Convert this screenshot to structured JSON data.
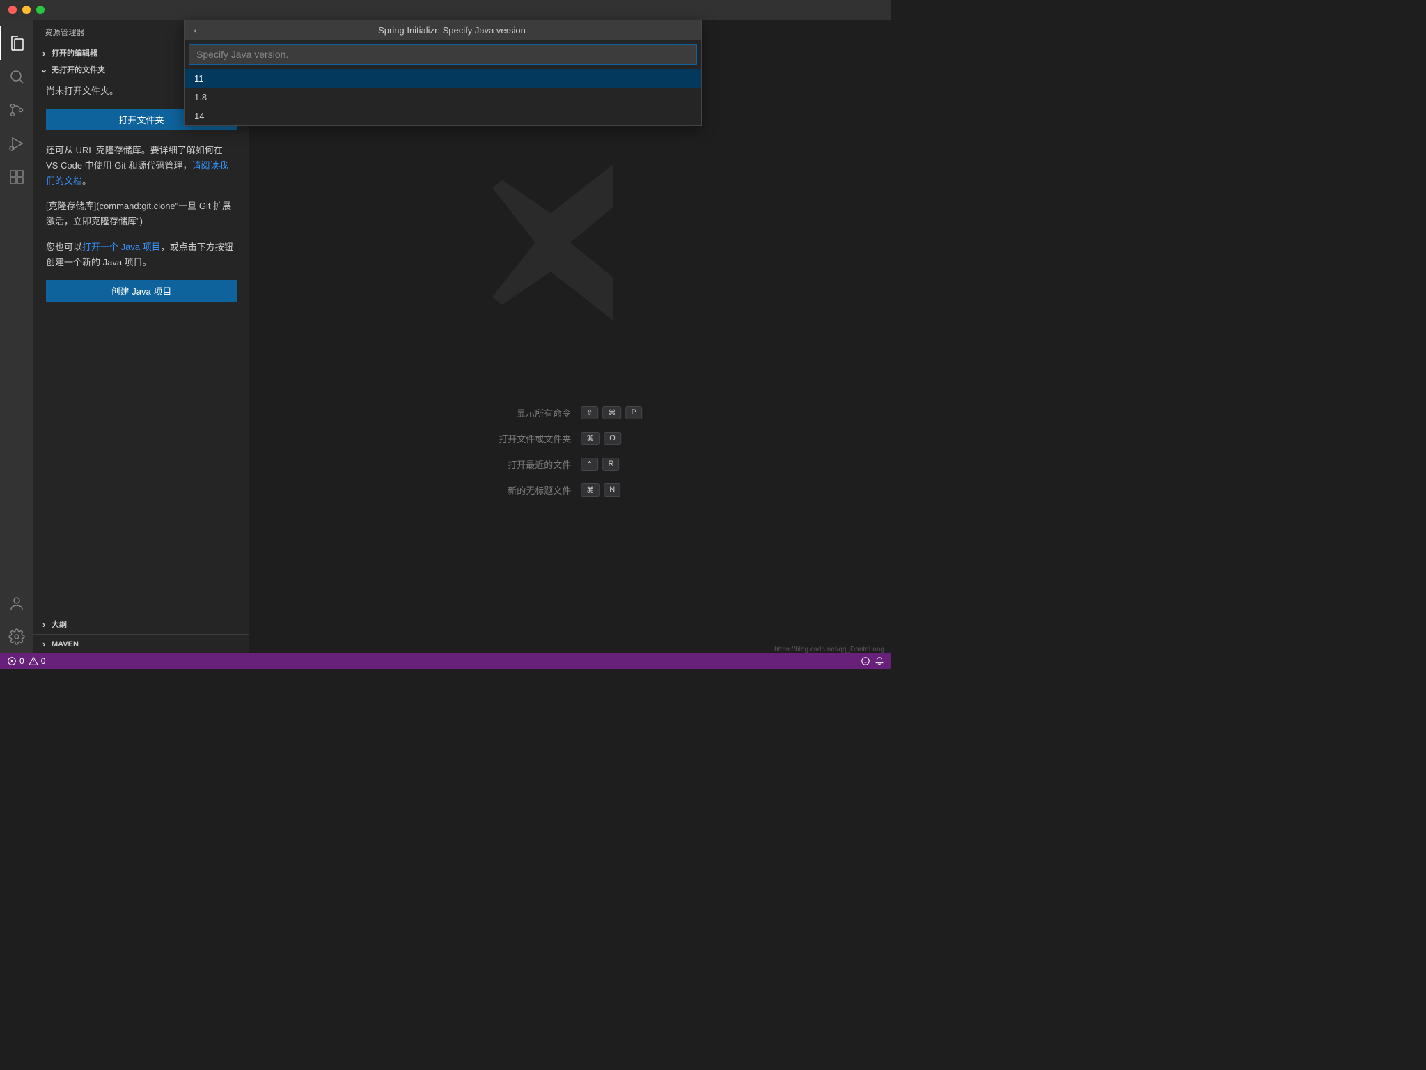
{
  "sidebar": {
    "title": "资源管理器",
    "sections": {
      "openEditors": "打开的编辑器",
      "noFolder": "无打开的文件夹",
      "outline": "大纲",
      "maven": "MAVEN"
    },
    "body": {
      "noFolderMsg": "尚未打开文件夹。",
      "openFolderBtn": "打开文件夹",
      "cloneText1": "还可从 URL 克隆存储库。要详细了解如何在 VS Code 中使用 Git 和源代码管理，",
      "cloneLink": "请阅读我们的文档",
      "cloneText2": "。",
      "cloneCommand": "[克隆存储库](command:git.clone\"一旦 Git 扩展激活，立即克隆存储库\")",
      "javaText1": "您也可以",
      "javaLink": "打开一个 Java 项目",
      "javaText2": "，或点击下方按钮创建一个新的 Java 项目。",
      "createJavaBtn": "创建 Java 项目"
    }
  },
  "quickpick": {
    "title": "Spring Initializr: Specify Java version",
    "placeholder": "Specify Java version.",
    "options": [
      "11",
      "1.8",
      "14"
    ]
  },
  "shortcuts": {
    "items": [
      {
        "label": "显示所有命令",
        "keys": [
          "⇧",
          "⌘",
          "P"
        ]
      },
      {
        "label": "打开文件或文件夹",
        "keys": [
          "⌘",
          "O"
        ]
      },
      {
        "label": "打开最近的文件",
        "keys": [
          "⌃",
          "R"
        ]
      },
      {
        "label": "新的无标题文件",
        "keys": [
          "⌘",
          "N"
        ]
      }
    ]
  },
  "statusbar": {
    "errors": "0",
    "warnings": "0",
    "watermark": "https://blog.csdn.net/qq_DanteLong"
  }
}
